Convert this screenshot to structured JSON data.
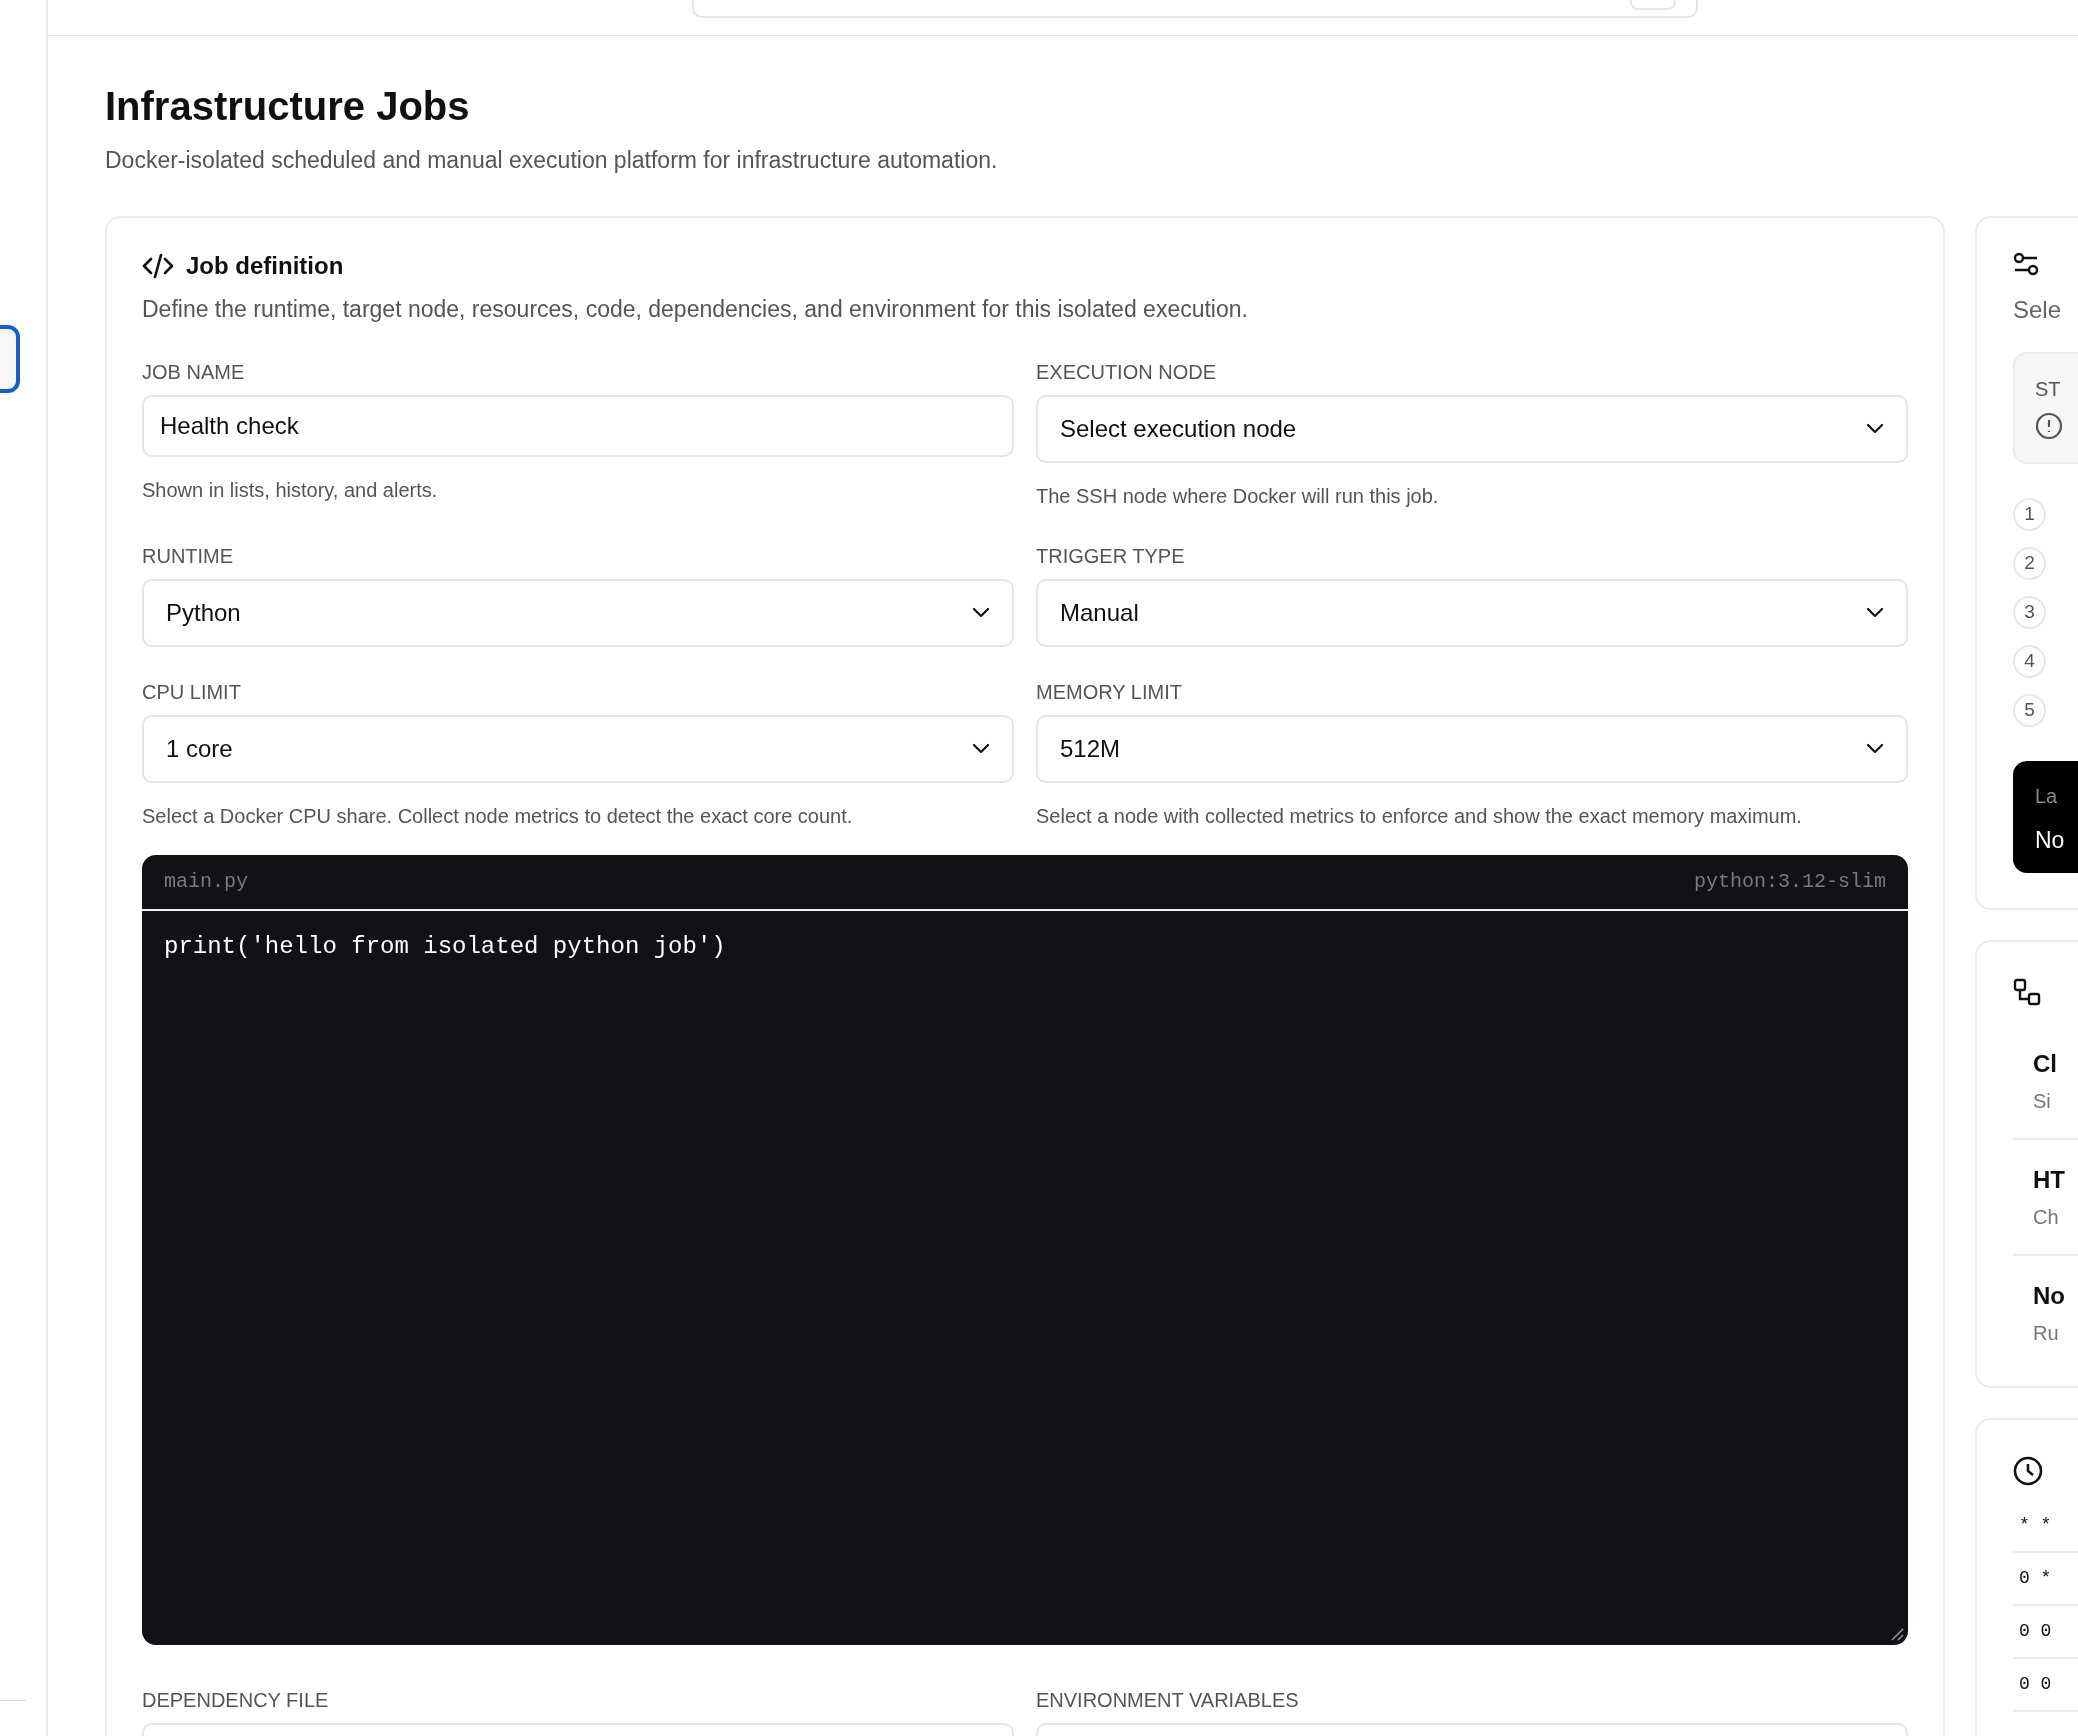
{
  "page": {
    "title": "Infrastructure Jobs",
    "subtitle": "Docker-isolated scheduled and manual execution platform for infrastructure automation."
  },
  "job_definition": {
    "title": "Job definition",
    "description": "Define the runtime, target node, resources, code, dependencies, and environment for this isolated execution.",
    "fields": [
      {
        "kind": "input",
        "label": "JOB NAME",
        "value": "Health check",
        "help": "Shown in lists, history, and alerts."
      },
      {
        "kind": "select",
        "label": "EXECUTION NODE",
        "value": "Select execution node",
        "help": "The SSH node where Docker will run this job."
      },
      {
        "kind": "select",
        "label": "RUNTIME",
        "value": "Python"
      },
      {
        "kind": "select",
        "label": "TRIGGER TYPE",
        "value": "Manual"
      },
      {
        "kind": "select",
        "label": "CPU LIMIT",
        "value": "1 core",
        "help": "Select a Docker CPU share. Collect node metrics to detect the exact core count."
      },
      {
        "kind": "select",
        "label": "MEMORY LIMIT",
        "value": "512M",
        "help": "Select a node with collected metrics to enforce and show the exact memory maximum."
      }
    ],
    "editor": {
      "filename": "main.py",
      "image": "python:3.12-slim",
      "code": "print('hello from isolated python job')"
    },
    "bottom_fields": [
      {
        "label": "DEPENDENCY FILE"
      },
      {
        "label": "ENVIRONMENT VARIABLES"
      }
    ]
  },
  "side_panels": {
    "status": {
      "text": "Sele",
      "status_label": "ST",
      "steps": [
        "1",
        "2",
        "3",
        "4",
        "5"
      ],
      "last_label": "La",
      "last_value": "No"
    },
    "templates": {
      "items": [
        {
          "title": "Cl",
          "subtitle": "Si"
        },
        {
          "title": "HT",
          "subtitle": "Ch"
        },
        {
          "title": "No",
          "subtitle": "Ru"
        }
      ]
    },
    "schedules": {
      "items": [
        "* *",
        "0 *",
        "0 0",
        "0 0"
      ]
    }
  }
}
